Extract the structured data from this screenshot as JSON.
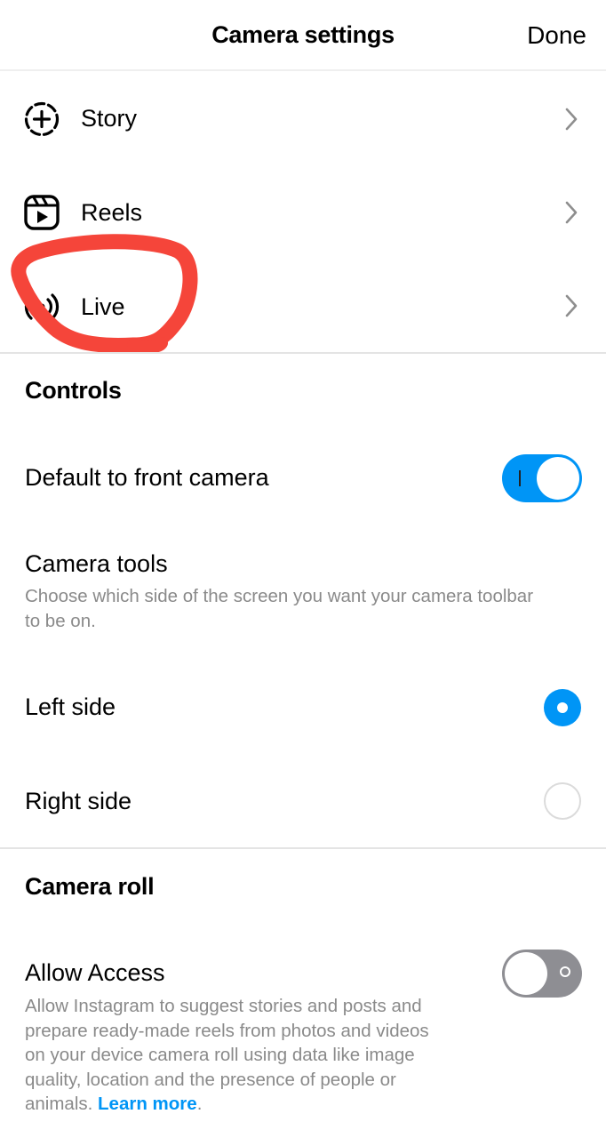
{
  "header": {
    "title": "Camera settings",
    "done_label": "Done"
  },
  "nav_items": [
    {
      "label": "Story",
      "icon": "story-add-icon"
    },
    {
      "label": "Reels",
      "icon": "reels-icon"
    },
    {
      "label": "Live",
      "icon": "live-icon"
    }
  ],
  "controls": {
    "section_title": "Controls",
    "front_camera": {
      "label": "Default to front camera",
      "enabled": true
    },
    "camera_tools": {
      "label": "Camera tools",
      "description_line1": "Choose which side of the screen you want your camera toolbar",
      "description_line2": "to be on."
    },
    "toolbar_side_options": [
      {
        "label": "Left side",
        "selected": true
      },
      {
        "label": "Right side",
        "selected": false
      }
    ]
  },
  "camera_roll": {
    "section_title": "Camera roll",
    "allow_access": {
      "label": "Allow Access",
      "enabled": false,
      "description_lines": [
        "Allow Instagram to suggest stories and posts and",
        "prepare ready-made reels from photos and videos",
        "on your device camera roll using data like image",
        "quality, location and the presence of people or"
      ],
      "description_last_prefix": "animals. ",
      "learn_more": "Learn more",
      "description_last_suffix": "."
    }
  },
  "colors": {
    "accent": "#0095f6",
    "toggle_off": "#8e8e93",
    "annotation": "#f5453a",
    "secondary_text": "#8a8a8a"
  },
  "annotation": {
    "type": "hand-drawn circle",
    "target": "Live"
  }
}
